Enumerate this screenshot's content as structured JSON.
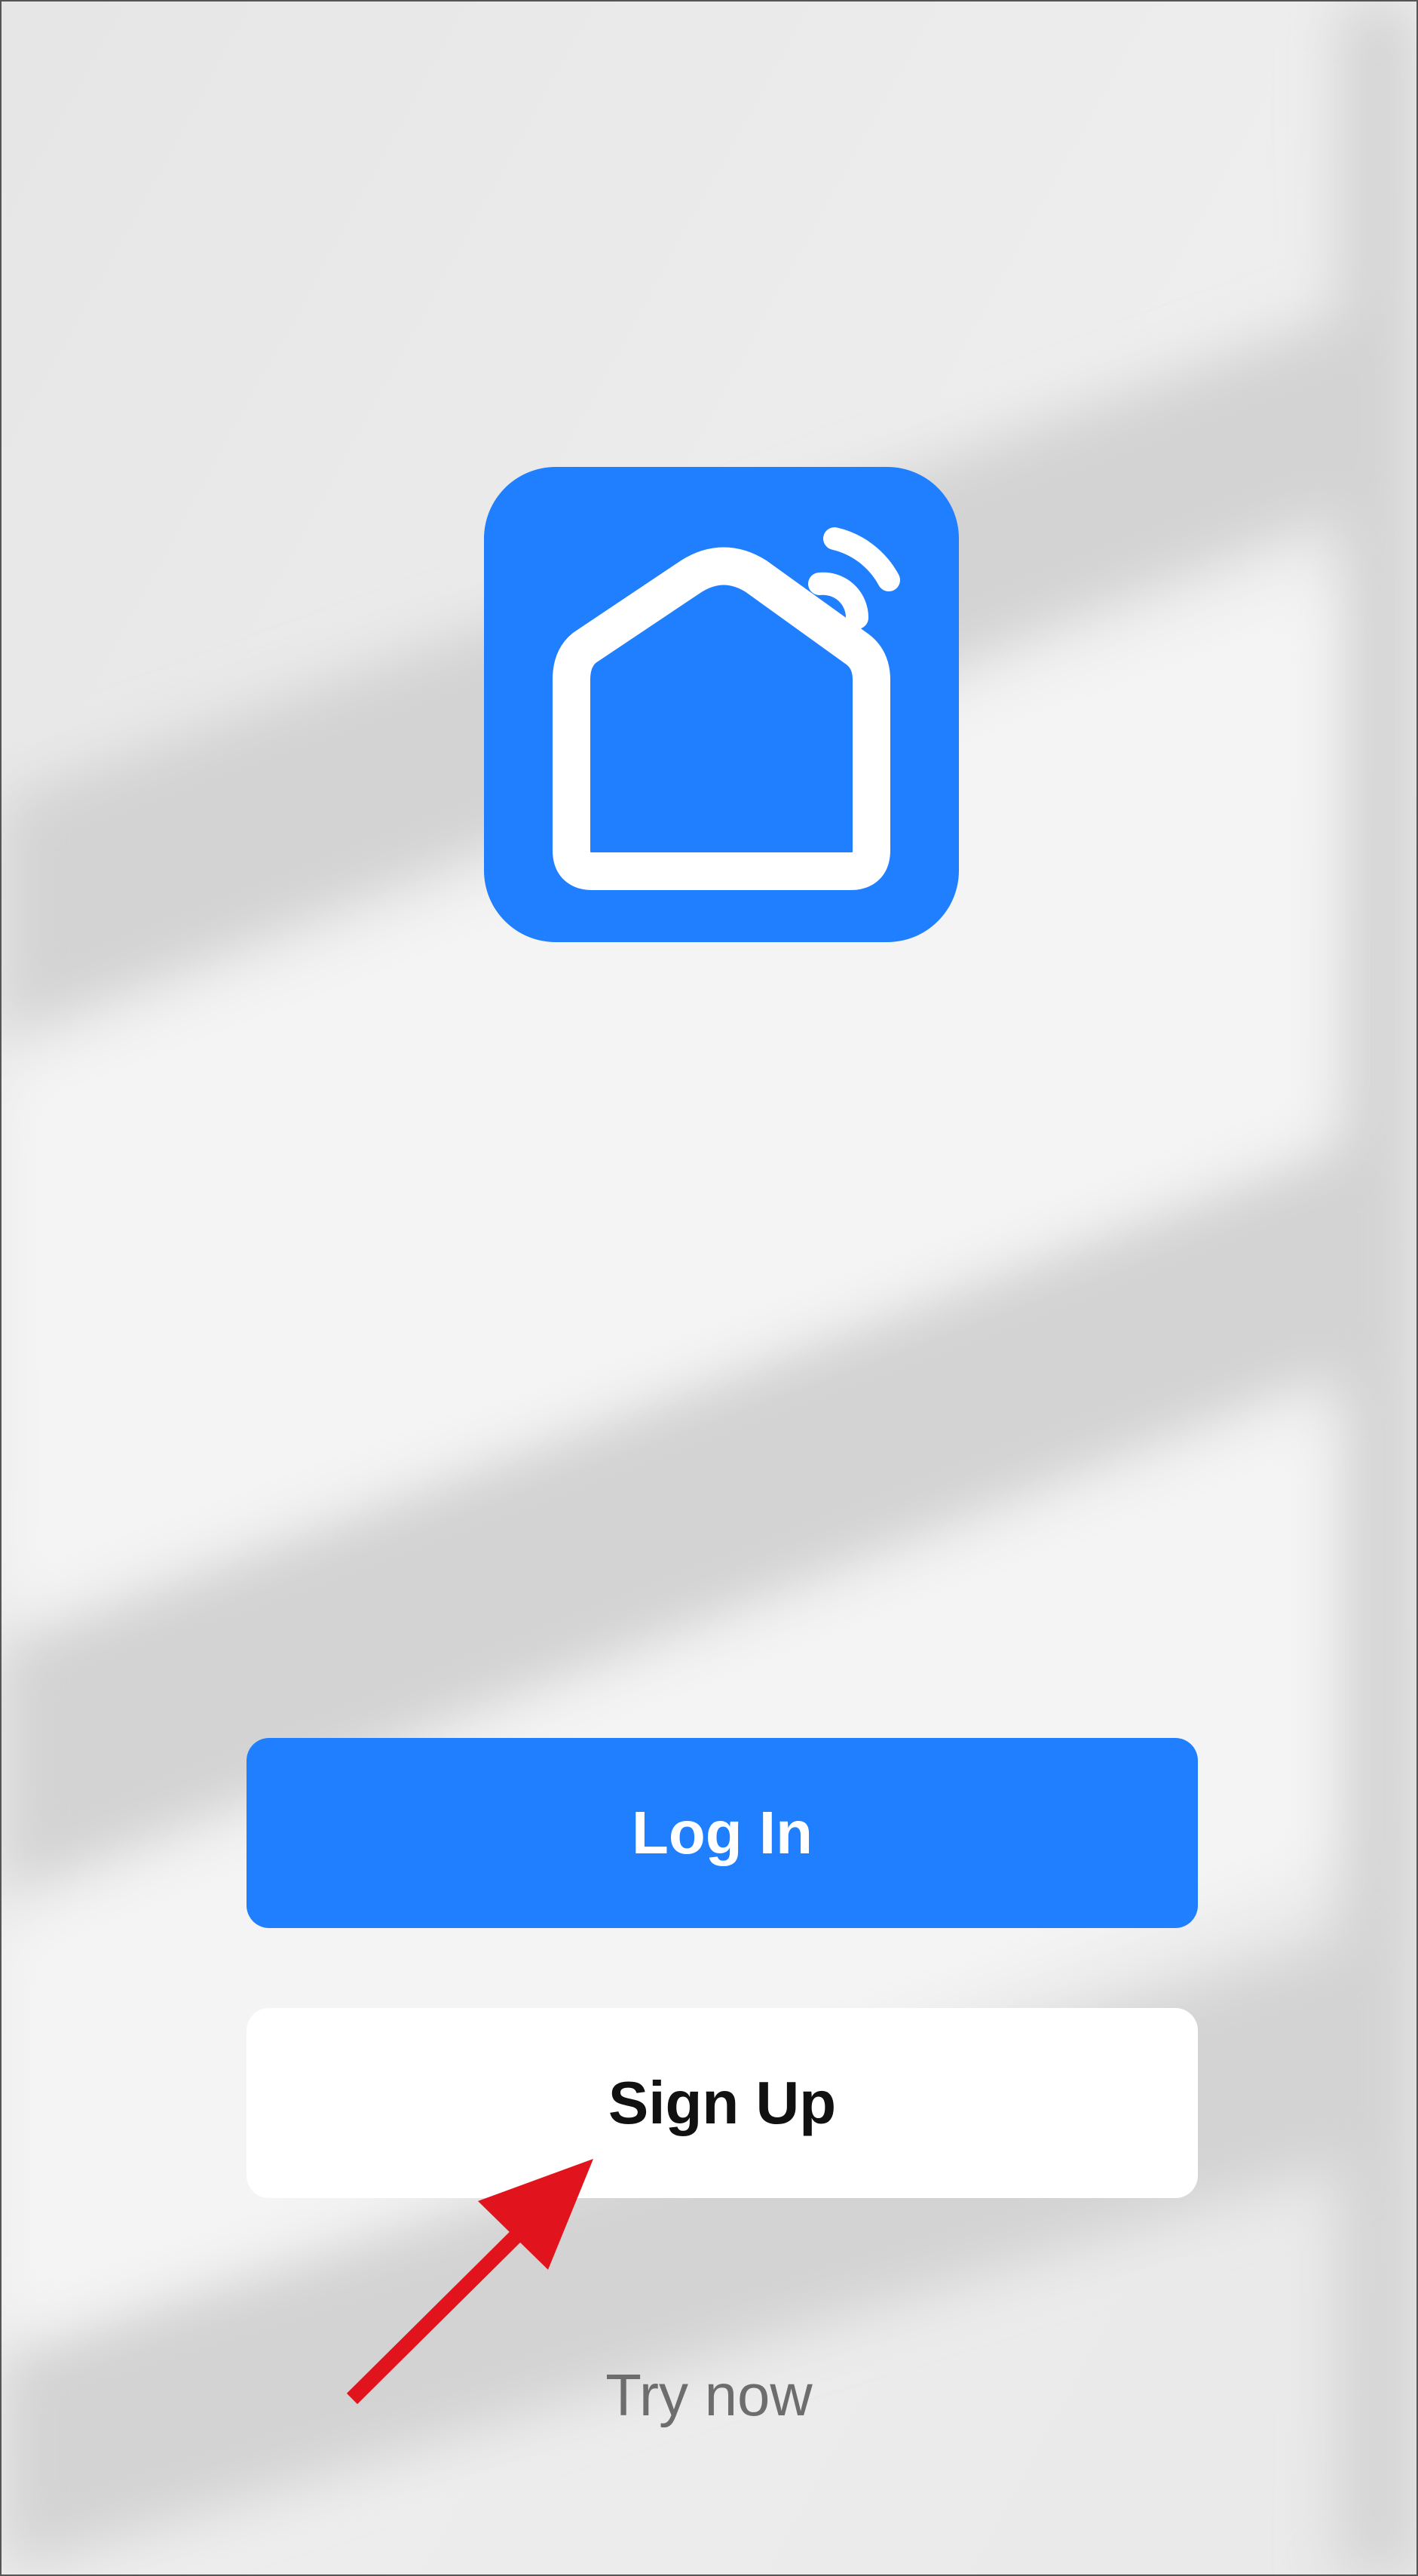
{
  "theme": {
    "accent": "#1f7ffe",
    "background": "#eeeeee",
    "annotation_arrow": "#e1131c"
  },
  "logo": {
    "icon": "smart-home-wifi-icon"
  },
  "buttons": {
    "login_label": "Log In",
    "signup_label": "Sign Up"
  },
  "try_now_label": "Try now",
  "annotation": {
    "icon": "red-arrow-icon",
    "points_to": "signup-button"
  }
}
